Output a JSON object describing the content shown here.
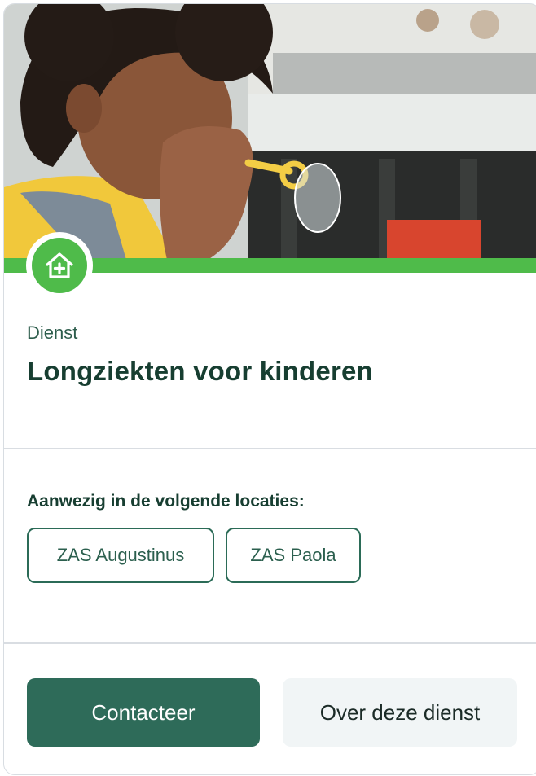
{
  "service": {
    "category": "Dienst",
    "title": "Longziekten voor kinderen",
    "icon": "house-plus-icon",
    "accent_color": "#4fbb4a"
  },
  "locations": {
    "heading": "Aanwezig in de volgende locaties:",
    "items": [
      {
        "label": "ZAS Augustinus"
      },
      {
        "label": "ZAS Paola"
      }
    ]
  },
  "actions": {
    "primary_label": "Contacteer",
    "secondary_label": "Over deze dienst",
    "primary_color": "#2e6b59"
  }
}
